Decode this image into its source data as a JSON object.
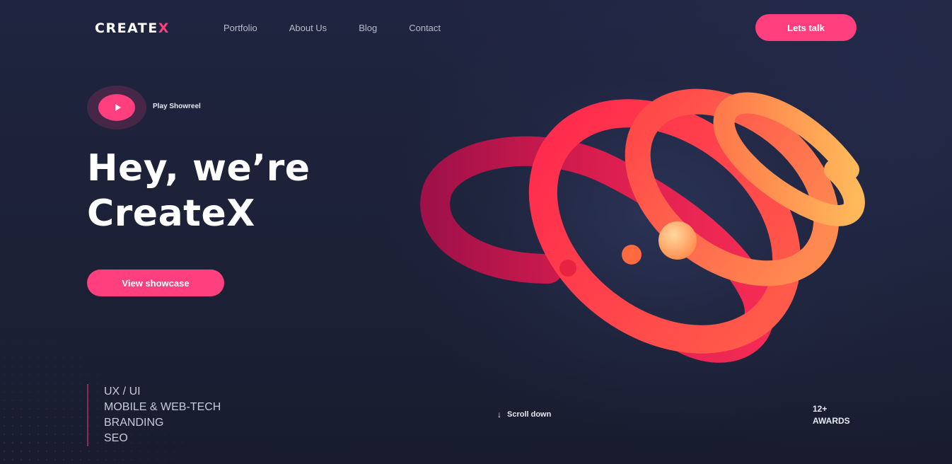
{
  "header": {
    "logo_main": "CREATE",
    "logo_accent": "X",
    "nav": [
      "Portfolio",
      "About Us",
      "Blog",
      "Contact"
    ],
    "cta_label": "Lets talk"
  },
  "hero": {
    "showreel_label": "Play Showreel",
    "title_line1": "Hey, we’re",
    "title_line2": "CreateX",
    "button_label": "View showcase"
  },
  "services": [
    "UX / UI",
    "MOBILE & WEB-TECH",
    "BRANDING",
    "SEO"
  ],
  "scroll": {
    "icon": "down-arrow-icon",
    "label": "Scroll down"
  },
  "awards": {
    "count": "12+",
    "label": "AWARDS"
  },
  "colors": {
    "accent": "#ff3f7e",
    "background": "#1d2237",
    "text": "#ffffff",
    "nav_text": "#b9bccb"
  }
}
